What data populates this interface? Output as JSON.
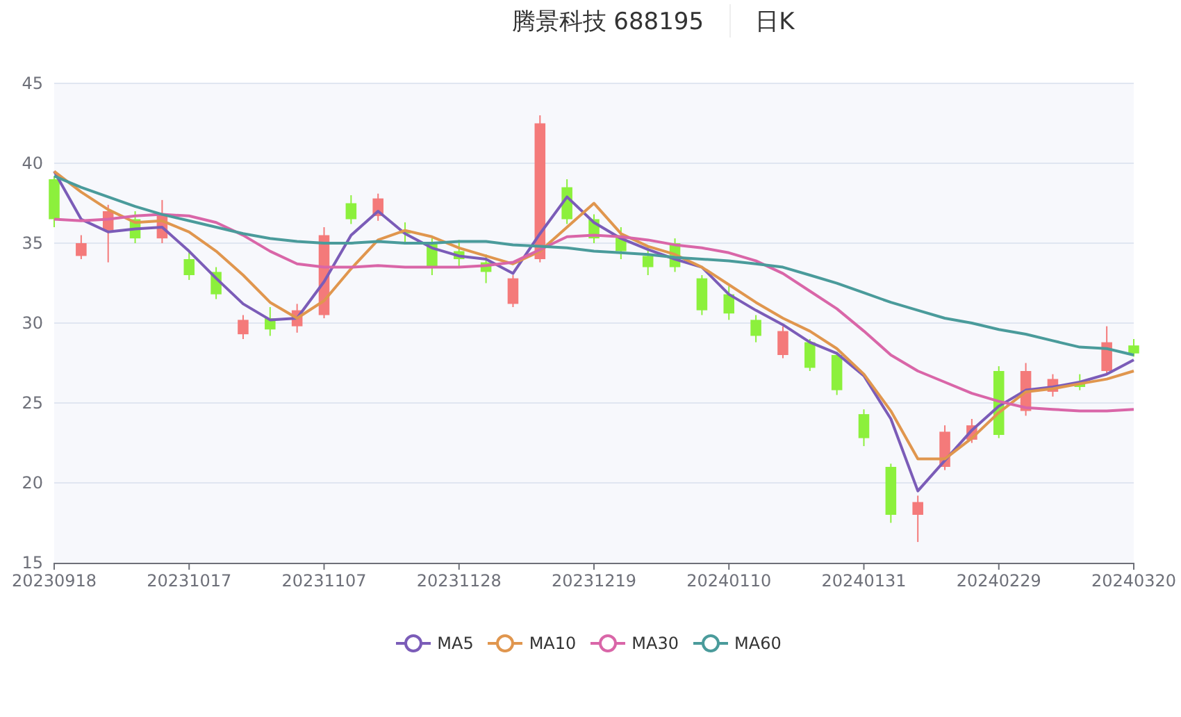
{
  "chart": {
    "title": "腾景科技 688195",
    "period": "日K",
    "chart_data": {
      "type": "candlestick",
      "categories": [
        "20230918",
        null,
        null,
        null,
        null,
        "20231017",
        null,
        null,
        null,
        null,
        "20231107",
        null,
        null,
        null,
        null,
        "20231128",
        null,
        null,
        null,
        null,
        "20231219",
        null,
        null,
        null,
        null,
        "20240110",
        null,
        null,
        null,
        null,
        "20240131",
        null,
        null,
        null,
        null,
        "20240229",
        null,
        null,
        null,
        null,
        "20240320"
      ],
      "grid": true,
      "ylim": [
        15,
        45
      ],
      "yticks": [
        15,
        20,
        25,
        30,
        35,
        40,
        45
      ],
      "ohlc": [
        [
          39,
          39.2,
          36,
          36.5
        ],
        [
          34.2,
          35.5,
          34,
          35
        ],
        [
          35.8,
          37.4,
          33.8,
          37
        ],
        [
          36.5,
          37,
          35,
          35.3
        ],
        [
          35.3,
          37.7,
          35,
          36.8
        ],
        [
          34,
          34.5,
          32.7,
          33
        ],
        [
          33.2,
          33.5,
          31.5,
          31.8
        ],
        [
          29.3,
          30.5,
          29,
          30.2
        ],
        [
          30.3,
          31,
          29.2,
          29.6
        ],
        [
          29.8,
          31.2,
          29.4,
          30.8
        ],
        [
          30.5,
          36,
          30.3,
          35.5
        ],
        [
          37.5,
          38,
          36.2,
          36.5
        ],
        [
          36.7,
          38.1,
          36.4,
          37.8
        ],
        [
          35.8,
          36.3,
          35,
          35.6
        ],
        [
          35,
          35.3,
          33,
          33.5
        ],
        [
          34.5,
          35.2,
          33.5,
          34
        ],
        [
          33.8,
          34.3,
          32.5,
          33.2
        ],
        [
          31.2,
          33,
          31,
          32.8
        ],
        [
          34,
          43,
          33.8,
          42.5
        ],
        [
          38.5,
          39,
          36.2,
          36.5
        ],
        [
          36.5,
          36.8,
          35,
          35.3
        ],
        [
          35.5,
          36,
          34,
          34.5
        ],
        [
          34.2,
          34.8,
          33,
          33.5
        ],
        [
          35,
          35.3,
          33.2,
          33.5
        ],
        [
          32.8,
          33,
          30.5,
          30.8
        ],
        [
          31.8,
          32.3,
          30.2,
          30.6
        ],
        [
          30.2,
          30.5,
          28.8,
          29.2
        ],
        [
          28,
          29.8,
          27.8,
          29.5
        ],
        [
          28.8,
          29,
          27,
          27.2
        ],
        [
          28,
          28.2,
          25.5,
          25.8
        ],
        [
          24.3,
          24.6,
          22.3,
          22.8
        ],
        [
          21,
          21.2,
          17.5,
          18
        ],
        [
          18,
          19.2,
          16.3,
          18.8
        ],
        [
          21,
          23.6,
          20.8,
          23.2
        ],
        [
          22.7,
          24,
          22.5,
          23.6
        ],
        [
          27,
          27.3,
          22.8,
          23
        ],
        [
          24.5,
          27.5,
          24.2,
          27
        ],
        [
          25.7,
          26.8,
          25.4,
          26.5
        ],
        [
          26.3,
          26.8,
          25.8,
          26
        ],
        [
          27,
          29.8,
          26.8,
          28.8
        ],
        [
          28.6,
          29,
          27.9,
          28.1
        ]
      ],
      "series": [
        {
          "name": "MA5",
          "type": "line",
          "color": "#7b5cb8",
          "values": [
            39.5,
            36.5,
            35.7,
            35.9,
            36,
            34.5,
            32.8,
            31.2,
            30.2,
            30.3,
            32.6,
            35.5,
            37,
            35.6,
            34.7,
            34.2,
            34,
            33.1,
            35.6,
            37.9,
            36.3,
            35.3,
            34.6,
            34,
            33.5,
            31.8,
            30.8,
            29.9,
            28.8,
            28.1,
            26.7,
            24,
            19.5,
            21.4,
            23.3,
            24.8,
            25.8,
            26,
            26.3,
            26.8,
            27.7
          ]
        },
        {
          "name": "MA10",
          "type": "line",
          "color": "#e0964e",
          "values": [
            39.5,
            38.2,
            37.1,
            36.3,
            36.4,
            35.7,
            34.5,
            33,
            31.3,
            30.3,
            31.4,
            33.4,
            35.2,
            35.8,
            35.4,
            34.7,
            34.2,
            33.7,
            34.5,
            36,
            37.5,
            35.6,
            34.8,
            34.3,
            33.5,
            32.4,
            31.3,
            30.3,
            29.5,
            28.4,
            26.8,
            24.5,
            21.5,
            21.5,
            22.8,
            24.4,
            25.7,
            25.9,
            26.2,
            26.5,
            27
          ]
        },
        {
          "name": "MA30",
          "type": "line",
          "color": "#d966a8",
          "values": [
            36.5,
            36.4,
            36.5,
            36.7,
            36.8,
            36.7,
            36.3,
            35.5,
            34.5,
            33.7,
            33.5,
            33.5,
            33.6,
            33.5,
            33.5,
            33.5,
            33.6,
            33.8,
            34.6,
            35.4,
            35.5,
            35.4,
            35.2,
            34.9,
            34.7,
            34.4,
            33.9,
            33.1,
            32,
            30.9,
            29.5,
            28,
            27,
            26.3,
            25.6,
            25.1,
            24.7,
            24.6,
            24.5,
            24.5,
            24.6
          ]
        },
        {
          "name": "MA60",
          "type": "line",
          "color": "#4a9b9b",
          "values": [
            39.2,
            38.5,
            37.9,
            37.3,
            36.8,
            36.4,
            36,
            35.6,
            35.3,
            35.1,
            35,
            35,
            35.1,
            35,
            35,
            35.1,
            35.1,
            34.9,
            34.8,
            34.7,
            34.5,
            34.4,
            34.3,
            34.1,
            34,
            33.9,
            33.7,
            33.5,
            33,
            32.5,
            31.9,
            31.3,
            30.8,
            30.3,
            30,
            29.6,
            29.3,
            28.9,
            28.5,
            28.4,
            28
          ]
        }
      ]
    }
  }
}
